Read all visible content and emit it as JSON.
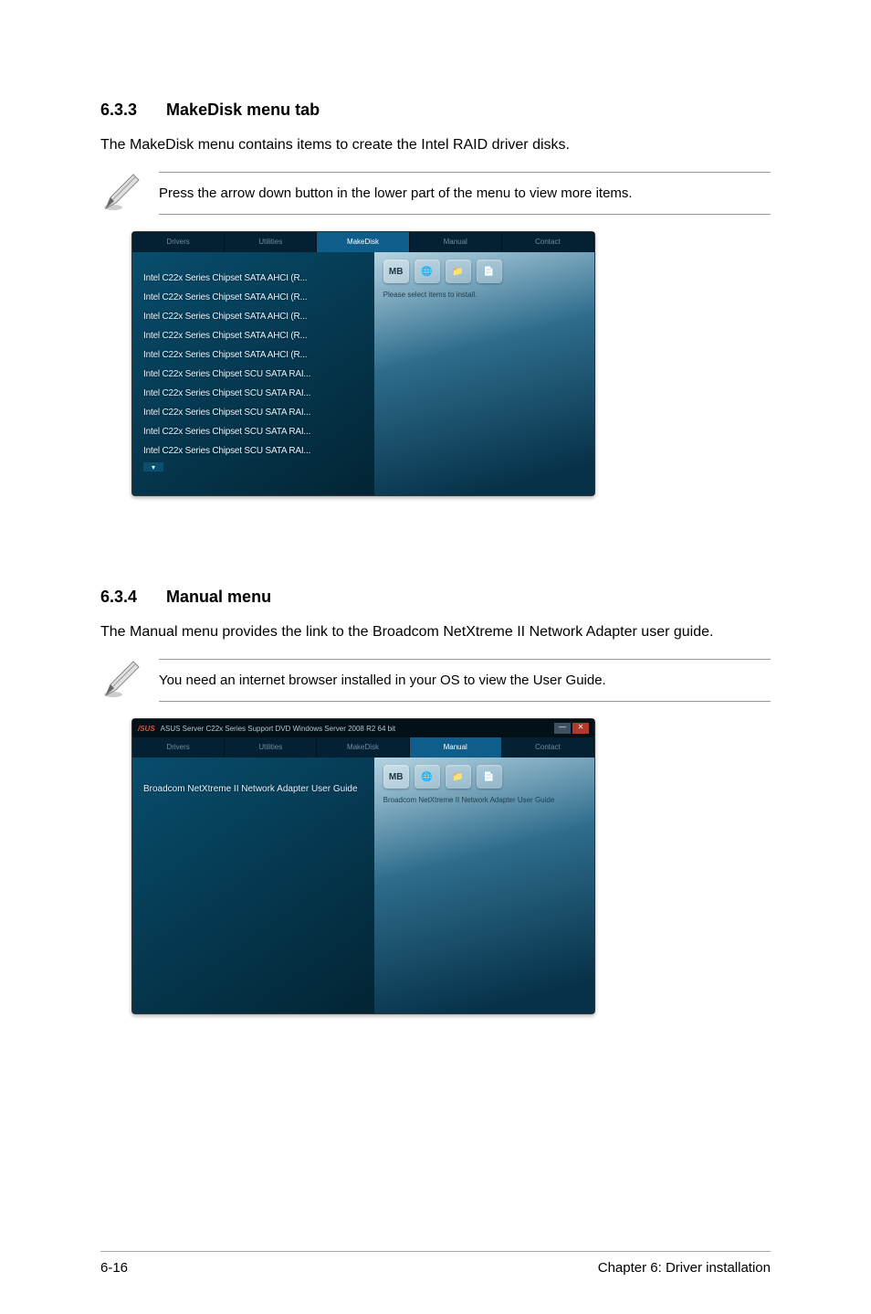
{
  "section1": {
    "number": "6.3.3",
    "title": "MakeDisk menu tab",
    "intro": "The MakeDisk menu contains items to create the Intel RAID driver disks.",
    "note": "Press the arrow down button in the lower part of the menu to view more items.",
    "screenshot": {
      "tabs": [
        "Drivers",
        "Utilities",
        "MakeDisk",
        "Manual",
        "Contact"
      ],
      "active_tab_index": 2,
      "right_hint": "Please select items to install.",
      "mb_label": "MB",
      "list": [
        "Intel C22x Series Chipset SATA AHCI (R...",
        "Intel C22x Series Chipset SATA AHCI (R...",
        "Intel C22x Series Chipset SATA AHCI (R...",
        "Intel C22x Series Chipset SATA AHCI (R...",
        "Intel C22x Series Chipset SATA AHCI (R...",
        "Intel C22x Series Chipset SCU SATA RAI...",
        "Intel C22x Series Chipset SCU SATA RAI...",
        "Intel C22x Series Chipset SCU SATA RAI...",
        "Intel C22x Series Chipset SCU SATA RAI...",
        "Intel C22x Series Chipset SCU SATA RAI..."
      ],
      "scroll_arrow": "▾"
    }
  },
  "section2": {
    "number": "6.3.4",
    "title": "Manual menu",
    "intro": "The Manual menu provides the link to the Broadcom NetXtreme II Network Adapter user guide.",
    "note": "You need an internet browser installed in your OS to view the User Guide.",
    "screenshot": {
      "titlebar_logo": "/SUS",
      "titlebar_text": "ASUS Server  C22x Series Support DVD    Windows Server 2008 R2 64 bit",
      "tabs": [
        "Drivers",
        "Utilities",
        "MakeDisk",
        "Manual",
        "Contact"
      ],
      "active_tab_index": 3,
      "mb_label": "MB",
      "left_item": "Broadcom NetXtreme II Network Adapter User Guide",
      "right_hint": "Broadcom NetXtreme II Network Adapter User Guide"
    }
  },
  "footer": {
    "left": "6-16",
    "right": "Chapter 6: Driver installation"
  },
  "icons": {
    "pencil": "pencil-note-icon",
    "mb": "mb-icon",
    "globe": "globe-icon",
    "folder": "folder-icon",
    "doc": "document-icon"
  }
}
